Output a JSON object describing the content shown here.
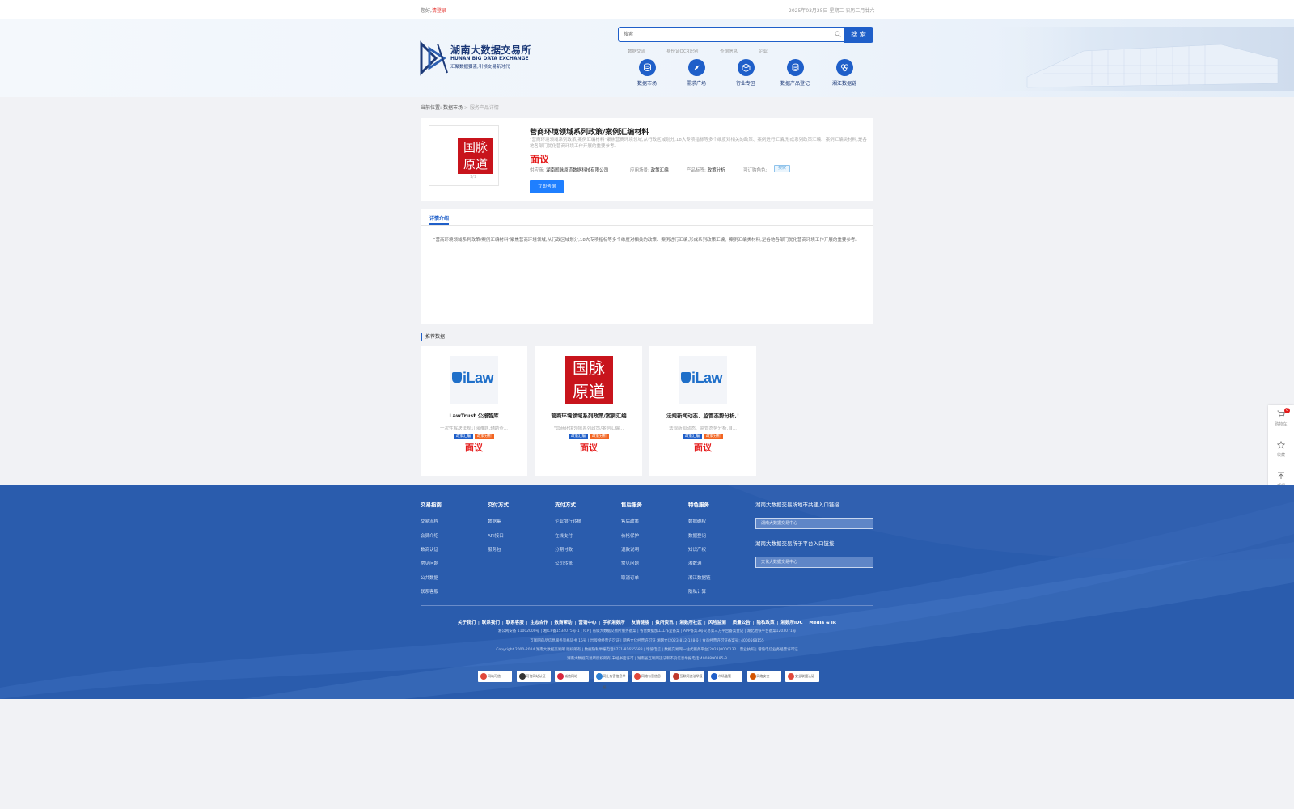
{
  "topbar": {
    "greeting": "您好,",
    "login": "请登录",
    "date": "2025年03月25日 星期二 农历二月廿六"
  },
  "logo": {
    "cn": "湖南大数据交易所",
    "en": "HUNAN BIG DATA EXCHANGE",
    "slogan": "汇聚数据要素,引领交易新时代"
  },
  "search": {
    "placeholder": "搜索",
    "button": "搜 索"
  },
  "quick_links": [
    "数据交流",
    "身份证OCR识别",
    "查询信息",
    "企业"
  ],
  "nav": [
    {
      "label": "数据市场",
      "icon": "database-icon"
    },
    {
      "label": "需求广场",
      "icon": "compass-icon"
    },
    {
      "label": "行业专区",
      "icon": "cube-icon"
    },
    {
      "label": "数据产品登记",
      "icon": "register-icon"
    },
    {
      "label": "湘江数据链",
      "icon": "link-icon"
    }
  ],
  "breadcrumb": {
    "prefix": "当前位置:",
    "level1": "数据市场",
    "sep": ">",
    "current": "服务产品详情"
  },
  "product": {
    "logo_line1": "国脉",
    "logo_line2": "原道",
    "thumb_counter": "1/1",
    "title": "营商环境领域系列政策/案例汇编材料",
    "desc": "\"营商环境领域系列政策/案例汇编材料\"聚焦营商环境领域,从行政区域划分,18大专项指标等多个维度对相关的政策、案例进行汇编,形成系列政策汇编、案例汇编类材料,是各地各部门优化营商环境工作开展的重要参考。",
    "price": "面议",
    "supplier_label": "供应商:",
    "supplier": "湖南国脉原道数据科技有限公司",
    "scene_label": "应用场景:",
    "scene": "政策汇编",
    "tag_label": "产品标签:",
    "tag": "政策分析",
    "role_label": "可订购角色:",
    "role": "买家",
    "consult_button": "立即咨询"
  },
  "detail": {
    "tab": "详情介绍",
    "text": "\"营商环境领域系列政策/案例汇编材料\"聚焦营商环境领域,从行政区域划分,18大专项指标等多个维度对相关的政策、案例进行汇编,形成系列政策汇编、案例汇编类材料,是各地各部门优化营商环境工作开展的重要参考。"
  },
  "recommend": {
    "title": "推荐数据",
    "items": [
      {
        "logo": "ilaw",
        "logo_text": "iLaw",
        "name": "LawTrust 公报智库",
        "sub": "一次性解决法规订阅难题,辅助查...",
        "tag1": "政策汇编",
        "tag2": "政策分析",
        "price": "面议"
      },
      {
        "logo": "guomai",
        "logo_line1": "国脉",
        "logo_line2": "原道",
        "name": "营商环境领域系列政策/案例汇编",
        "sub": "\"营商环境领域系列政策/案例汇编...",
        "tag1": "政策汇编",
        "tag2": "政策分析",
        "price": "面议"
      },
      {
        "logo": "ilaw",
        "logo_text": "iLaw",
        "name": "法规新闻动态、监管态势分析,!",
        "sub": "法规新闻动态、监管态势分析,自...",
        "tag1": "政策汇编",
        "tag2": "政策分析",
        "price": "面议"
      }
    ]
  },
  "float": {
    "cart": "购物车",
    "cart_count": "0",
    "favorite": "收藏",
    "top": "顶部"
  },
  "footer": {
    "columns": [
      {
        "title": "交易指南",
        "links": [
          "交易流程",
          "会员介绍",
          "数商认证",
          "常见问题",
          "公共数据",
          "联系客服"
        ]
      },
      {
        "title": "交付方式",
        "links": [
          "数据集",
          "API接口",
          "服务包"
        ]
      },
      {
        "title": "支付方式",
        "links": [
          "企业银行转账",
          "在线支付",
          "分期付款",
          "公司转账"
        ]
      },
      {
        "title": "售后服务",
        "links": [
          "售后政策",
          "价格保护",
          "退款说明",
          "常见问题",
          "取消订单"
        ]
      },
      {
        "title": "特色服务",
        "links": [
          "数据确权",
          "数据登记",
          "知识产权",
          "湘数通",
          "湘江数据链",
          "隐私计算"
        ]
      }
    ],
    "city_title": "湖南大数据交易所地市共建入口链接",
    "city_select": "湖南大数据交易中心",
    "sub_title": "湖南大数据交易所子平台入口链接",
    "sub_select": "文化大数据交易中心",
    "links": [
      "关于我们",
      "联系我们",
      "联系客服",
      "生态合作",
      "数商帮助",
      "营销中心",
      "手机湘数所",
      "友情链接",
      "数所资讯",
      "湘数所社区",
      "风险监测",
      "质量公告",
      "隐私政策",
      "湘数所IDC",
      "Media & IR"
    ],
    "legal_lines": [
      "湘公网安备 11002000号 | 湘ICP备1534075号-1 | ICP | 省级大数据交易所服务备案 | 省营数据加工工作室备案 | APP备案3号交易第三方平台备案登记 | 湖北地铁平台备案1203071号",
      "互联网药品信息服务资格证书 15号 | 出版物经营许可证 | 网络文化经营许可证 湘网文(2023)812-128号 | 食品经营许可证备案号: 4000568155",
      "Copyright 2000-2024 湖南大数据交易所 版权所有 | 数据隐私举报电话0731-81655588 | 增值电信 | 数据交易网一站式服务平台[2023]0000132 | 营业执照 | 增值电信业务经营许可证",
      "湖南大数据交易所版权所有,未经书面许可 | 湖南省互联网违法和不良信息举报电话:4008890185-3"
    ],
    "badges": [
      "网站可信",
      "可信网站认证",
      "诚信网站",
      "网上有害信息举报",
      "网络有害信息",
      "互联网违法举报",
      "市场监管",
      "网络安全",
      "安全联盟认证"
    ]
  }
}
